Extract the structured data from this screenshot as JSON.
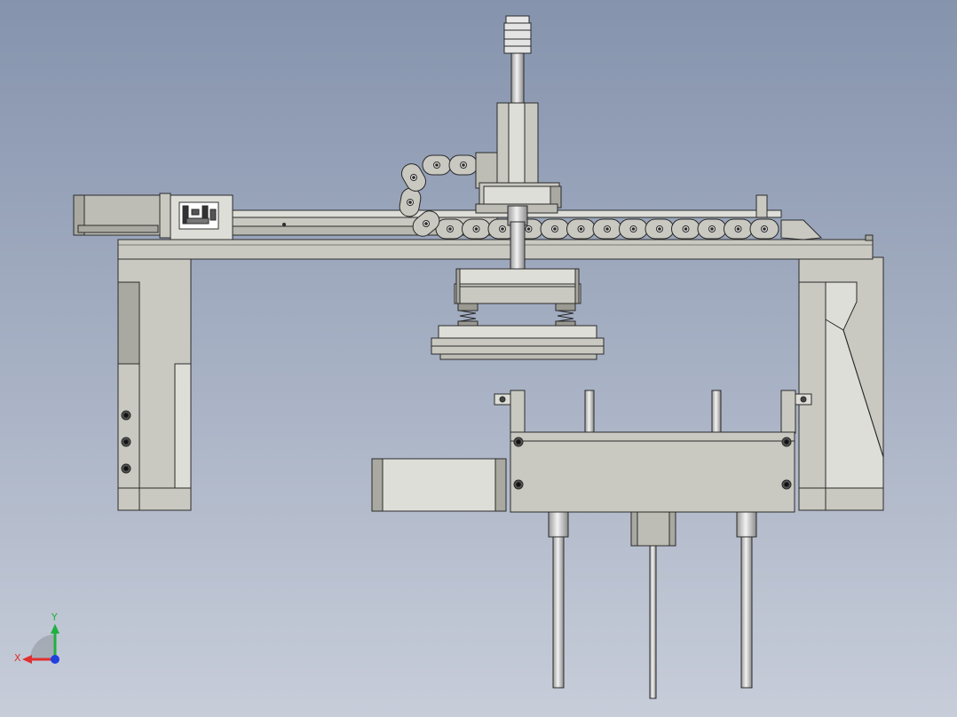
{
  "viewport": {
    "background_top": "#8593ad",
    "background_bottom": "#c7cdd9"
  },
  "colors": {
    "part_fill": "#c9c9c1",
    "part_fill_dark": "#a9a9a2",
    "part_fill_light": "#deded8",
    "edge": "#2a2a2a",
    "rod_fill": "#d8d8d8",
    "motor_fill": "#bdbdb5"
  },
  "triad": {
    "x_label": "X",
    "y_label": "Y",
    "x_color": "#e03030",
    "y_color": "#20b040",
    "z_color": "#2040e0"
  }
}
